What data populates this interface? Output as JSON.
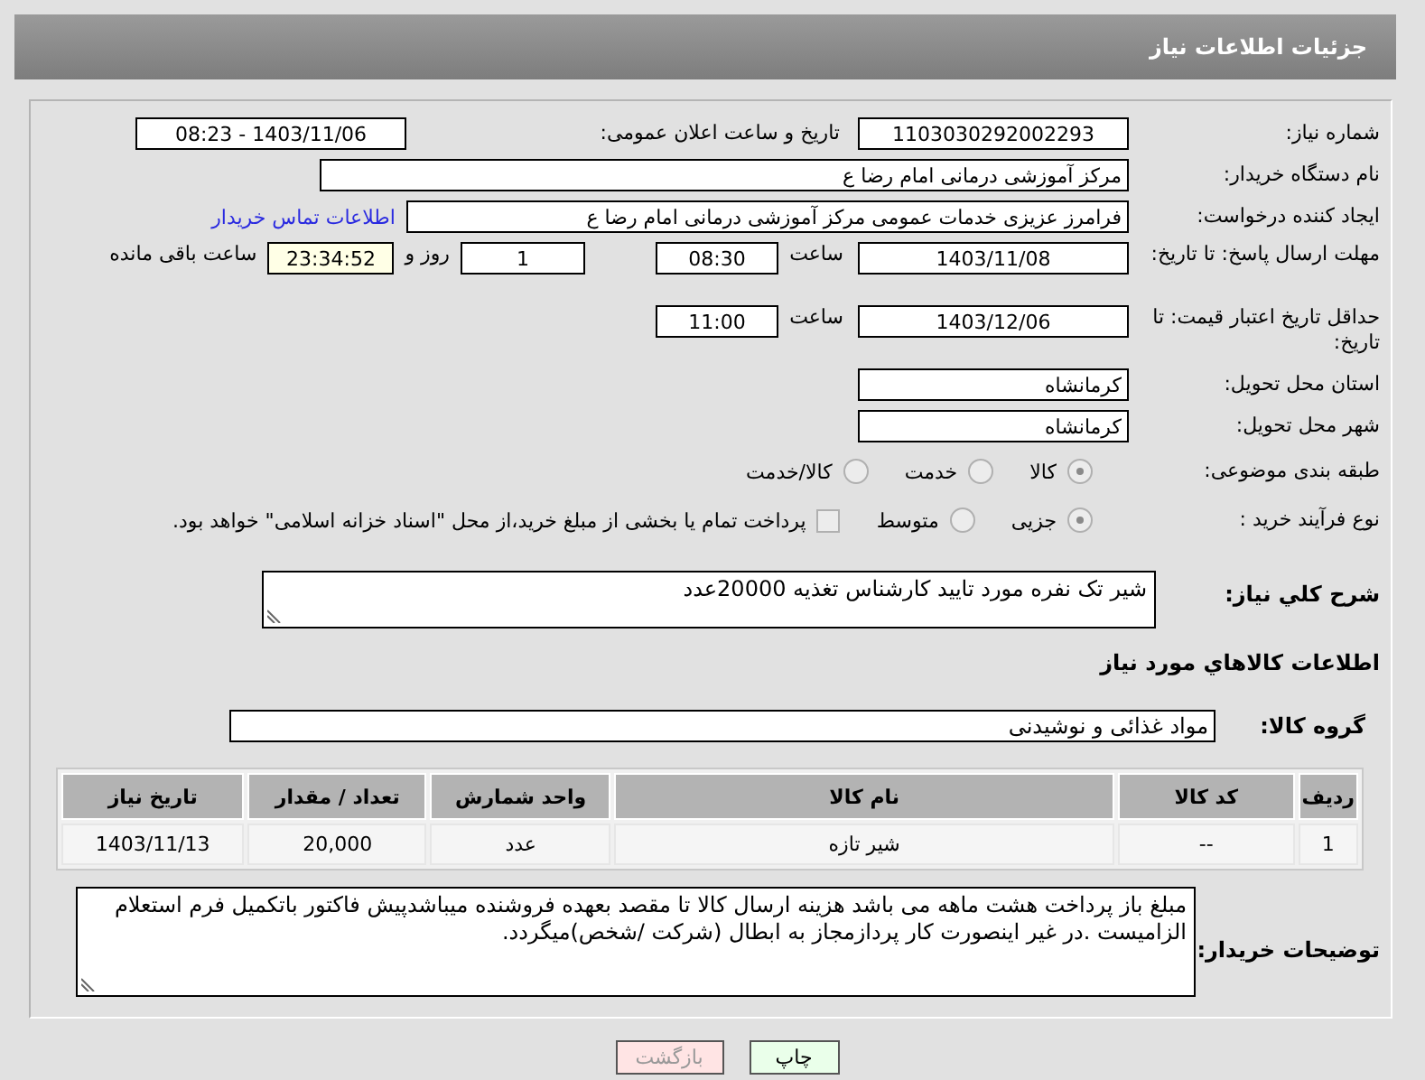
{
  "header": {
    "title": "جزئیات اطلاعات نیاز"
  },
  "need_number": {
    "label": "شماره نیاز:",
    "value": "1103030292002293"
  },
  "announce": {
    "label": "تاریخ و ساعت اعلان عمومی:",
    "value": "1403/11/06 - 08:23"
  },
  "buyer": {
    "label": "نام دستگاه خریدار:",
    "value": "مرکز آموزشی  درمانی امام رضا  ع"
  },
  "creator": {
    "label": "ایجاد کننده درخواست:",
    "value": "فرامرز عزیزی خدمات عمومی مرکز آموزشی  درمانی امام رضا  ع",
    "link": "اطلاعات تماس خریدار"
  },
  "deadline": {
    "label": "مهلت ارسال پاسخ: تا تاریخ:",
    "date": "1403/11/08",
    "time_label": "ساعت",
    "time": "08:30",
    "days": "1",
    "days_label": "روز و",
    "remaining": "23:34:52",
    "remaining_label": "ساعت باقی مانده"
  },
  "validity": {
    "label": "حداقل تاریخ اعتبار قیمت: تا تاریخ:",
    "date": "1403/12/06",
    "time_label": "ساعت",
    "time": "11:00"
  },
  "province": {
    "label": "استان محل تحویل:",
    "value": "کرمانشاه"
  },
  "city": {
    "label": "شهر محل تحویل:",
    "value": "کرمانشاه"
  },
  "category": {
    "label": "طبقه بندی موضوعی:",
    "options": [
      {
        "label": "کالا",
        "selected": true
      },
      {
        "label": "خدمت",
        "selected": false
      },
      {
        "label": "کالا/خدمت",
        "selected": false
      }
    ]
  },
  "process": {
    "label": "نوع فرآیند خرید :",
    "options": [
      {
        "label": "جزیی",
        "selected": true
      },
      {
        "label": "متوسط",
        "selected": false
      }
    ],
    "treasury": {
      "label": "پرداخت تمام یا بخشی از مبلغ خرید،از محل \"اسناد خزانه اسلامی\" خواهد بود.",
      "checked": false
    }
  },
  "description": {
    "label": "شرح کلي نياز:",
    "value": "شیر تک نفره مورد تایید کارشناس تغذیه  20000عدد"
  },
  "goods_heading": "اطلاعات كالاهاي مورد نياز",
  "goods_group": {
    "label": "گروه کالا:",
    "value": "مواد غذائی و نوشیدنی"
  },
  "table": {
    "columns": [
      "ردیف",
      "کد کالا",
      "نام کالا",
      "واحد شمارش",
      "تعداد / مقدار",
      "تاریخ نیاز"
    ],
    "rows": [
      [
        "1",
        "--",
        "شیر تازه",
        "عدد",
        "20,000",
        "1403/11/13"
      ]
    ]
  },
  "buyer_notes": {
    "label": "توضیحات خریدار:",
    "value": "مبلغ باز پرداخت هشت ماهه می باشد هزینه ارسال کالا تا مقصد بعهده فروشنده میباشدپیش فاکتور باتکمیل فرم استعلام الزامیست .در غیر اینصورت کار پردازمجاز به ابطال (شرکت /شخص)میگردد."
  },
  "buttons": [
    {
      "kind": "print",
      "label": "چاپ"
    },
    {
      "kind": "back",
      "label": "بازگشت"
    }
  ]
}
